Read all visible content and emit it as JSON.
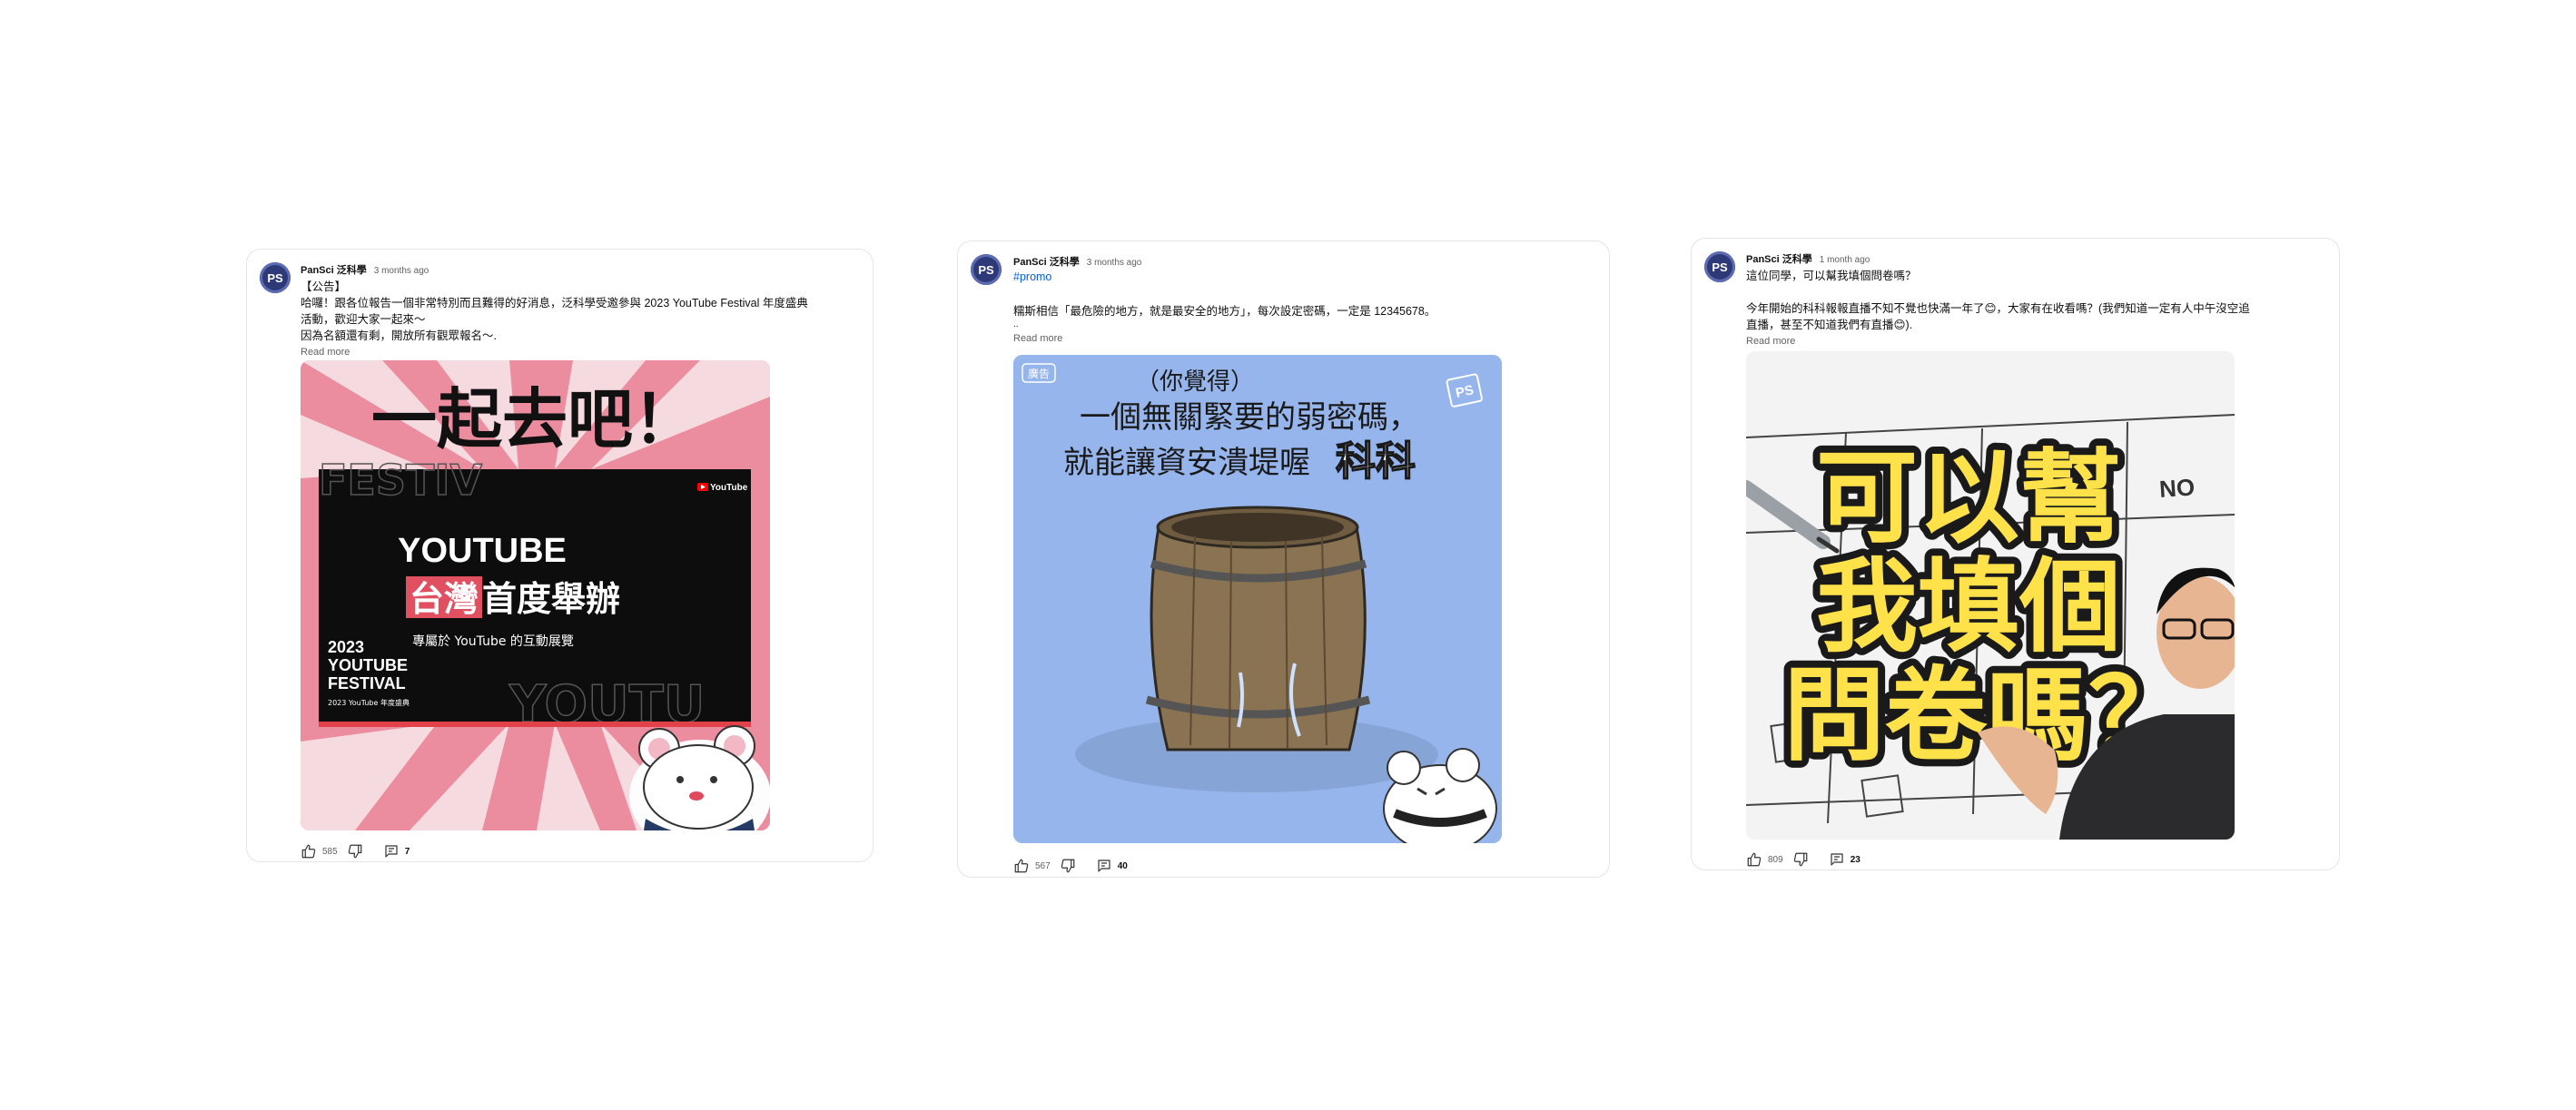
{
  "posts": [
    {
      "avatar_text": "PS",
      "channel": "PanSci 泛科學",
      "time": "3 months ago",
      "lines": [
        "【公告】",
        "哈囉！跟各位報告一個非常特別而且難得的好消息，泛科學受邀參與 2023 YouTube Festival 年度盛典",
        "活動，歡迎大家一起來～",
        "因為名額還有剩，開放所有觀眾報名～."
      ],
      "read_more": "Read more",
      "likes": "585",
      "comments": "7",
      "image": {
        "headline": "一起去吧！",
        "panel_title": "YOUTUBE",
        "panel_highlight": "台灣",
        "panel_subtitle": "首度舉辦",
        "panel_caption": "專屬於 YouTube 的互動展覽",
        "event_line1": "2023",
        "event_line2": "YOUTUBE",
        "event_line3": "FESTIVAL",
        "event_small": "2023 YouTube 年度盛典",
        "yt_logo": "YouTube",
        "bg_text_top": "FESTIV",
        "bg_text_bottom": "YOUTU"
      }
    },
    {
      "avatar_text": "PS",
      "channel": "PanSci 泛科學",
      "time": "3 months ago",
      "hashtag": "#promo",
      "lines": [
        "",
        "糯斯相信「最危險的地方，就是最安全的地方」，每次設定密碼，一定是 12345678。",
        ".."
      ],
      "read_more": "Read more",
      "likes": "567",
      "comments": "40",
      "image": {
        "ad_tag": "廣告",
        "line1": "（你覺得）",
        "line2": "一個無關緊要的弱密碼，",
        "line3": "就能讓資安潰堤喔",
        "line3_emph": "科科",
        "logo": "PS"
      }
    },
    {
      "avatar_text": "PS",
      "channel": "PanSci 泛科學",
      "time": "1 month ago",
      "lines": [
        "這位同學，可以幫我填個問卷嗎？",
        "",
        "今年開始的科科報報直播不知不覺也快滿一年了😊，大家有在收看嗎？(我們知道一定有人中午沒空追",
        "直播，甚至不知道我們有直播😊)."
      ],
      "read_more": "Read more",
      "likes": "809",
      "comments": "23",
      "image": {
        "line1": "可以幫",
        "line2": "我填個",
        "line3": "問卷嗎？",
        "form_no": "NO"
      }
    }
  ],
  "colors": {
    "link_blue": "#065fd4",
    "meta_gray": "#606060",
    "card_border": "#e5e5e5",
    "yt_red": "#ff0000"
  },
  "icons": [
    "thumb-up-icon",
    "thumb-down-icon",
    "comment-icon"
  ]
}
